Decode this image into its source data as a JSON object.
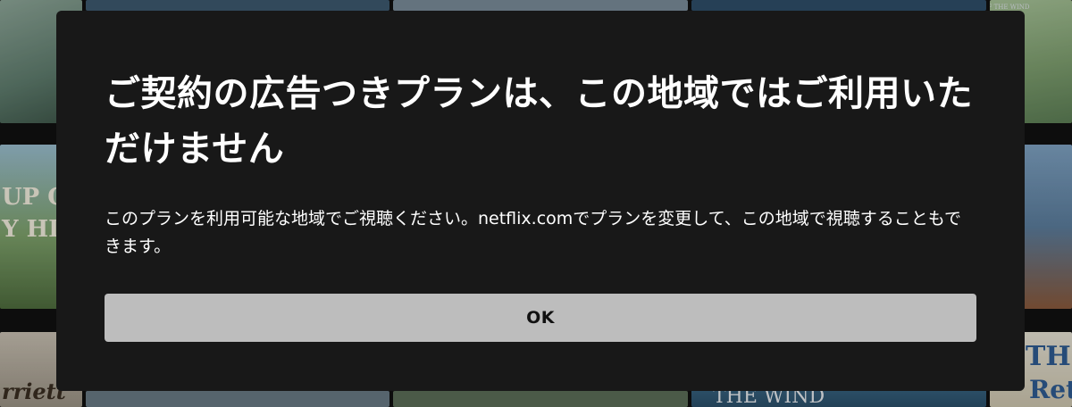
{
  "dialog": {
    "title": "ご契約の広告つきプランは、この地域ではご利用いただけません",
    "message": "このプランを利用可能な地域でご視聴ください。netflix.comでプランを変更して、この地域で視聴することもできます。",
    "ok_label": "OK"
  },
  "background": {
    "tile_texts": [
      "UP ON",
      "Y HILL",
      "rriett",
      "THE WIND",
      "OF THE VALLEY OF THE WIND",
      "THE",
      "Ret"
    ]
  },
  "colors": {
    "modal_background": "#181818",
    "button_background": "#bdbdbd",
    "text": "#ffffff",
    "button_text": "#111111"
  }
}
